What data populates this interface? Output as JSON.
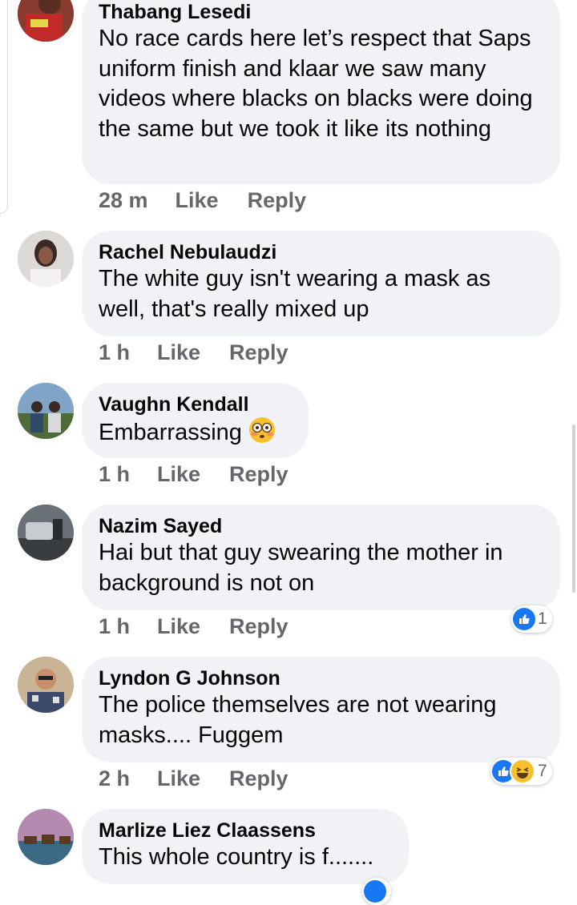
{
  "comments": [
    {
      "author": "Thabang Lesedi",
      "text": "No race cards here let’s respect that Saps uniform finish and klaar we saw many videos where blacks on blacks were doing the same but we took it like its nothing",
      "time": "28 m",
      "like": "Like",
      "reply": "Reply"
    },
    {
      "author": "Rachel Nebulaudzi",
      "text": "The white guy isn't wearing a mask as well, that's really mixed up",
      "time": "1 h",
      "like": "Like",
      "reply": "Reply"
    },
    {
      "author": "Vaughn Kendall",
      "text": "Embarrassing",
      "time": "1 h",
      "like": "Like",
      "reply": "Reply"
    },
    {
      "author": "Nazim Sayed",
      "text": "Hai but that guy swearing the mother in background is not on",
      "time": "1 h",
      "like": "Like",
      "reply": "Reply",
      "reactions": "1"
    },
    {
      "author": "Lyndon G Johnson",
      "text": "The police themselves are not wearing masks.... Fuggem",
      "time": "2 h",
      "like": "Like",
      "reply": "Reply",
      "reactions": "7"
    },
    {
      "author": "Marlize Liez Claassens",
      "text": "This whole country is f.......",
      "time": "",
      "like": "",
      "reply": ""
    }
  ],
  "icons": {
    "like": "like-reaction-icon",
    "haha": "haha-reaction-icon",
    "emoji": "flushed-face-emoji"
  },
  "colors": {
    "bubble": "#f0f2f5",
    "like_blue": "#1877f2",
    "meta_gray": "#65676b"
  }
}
